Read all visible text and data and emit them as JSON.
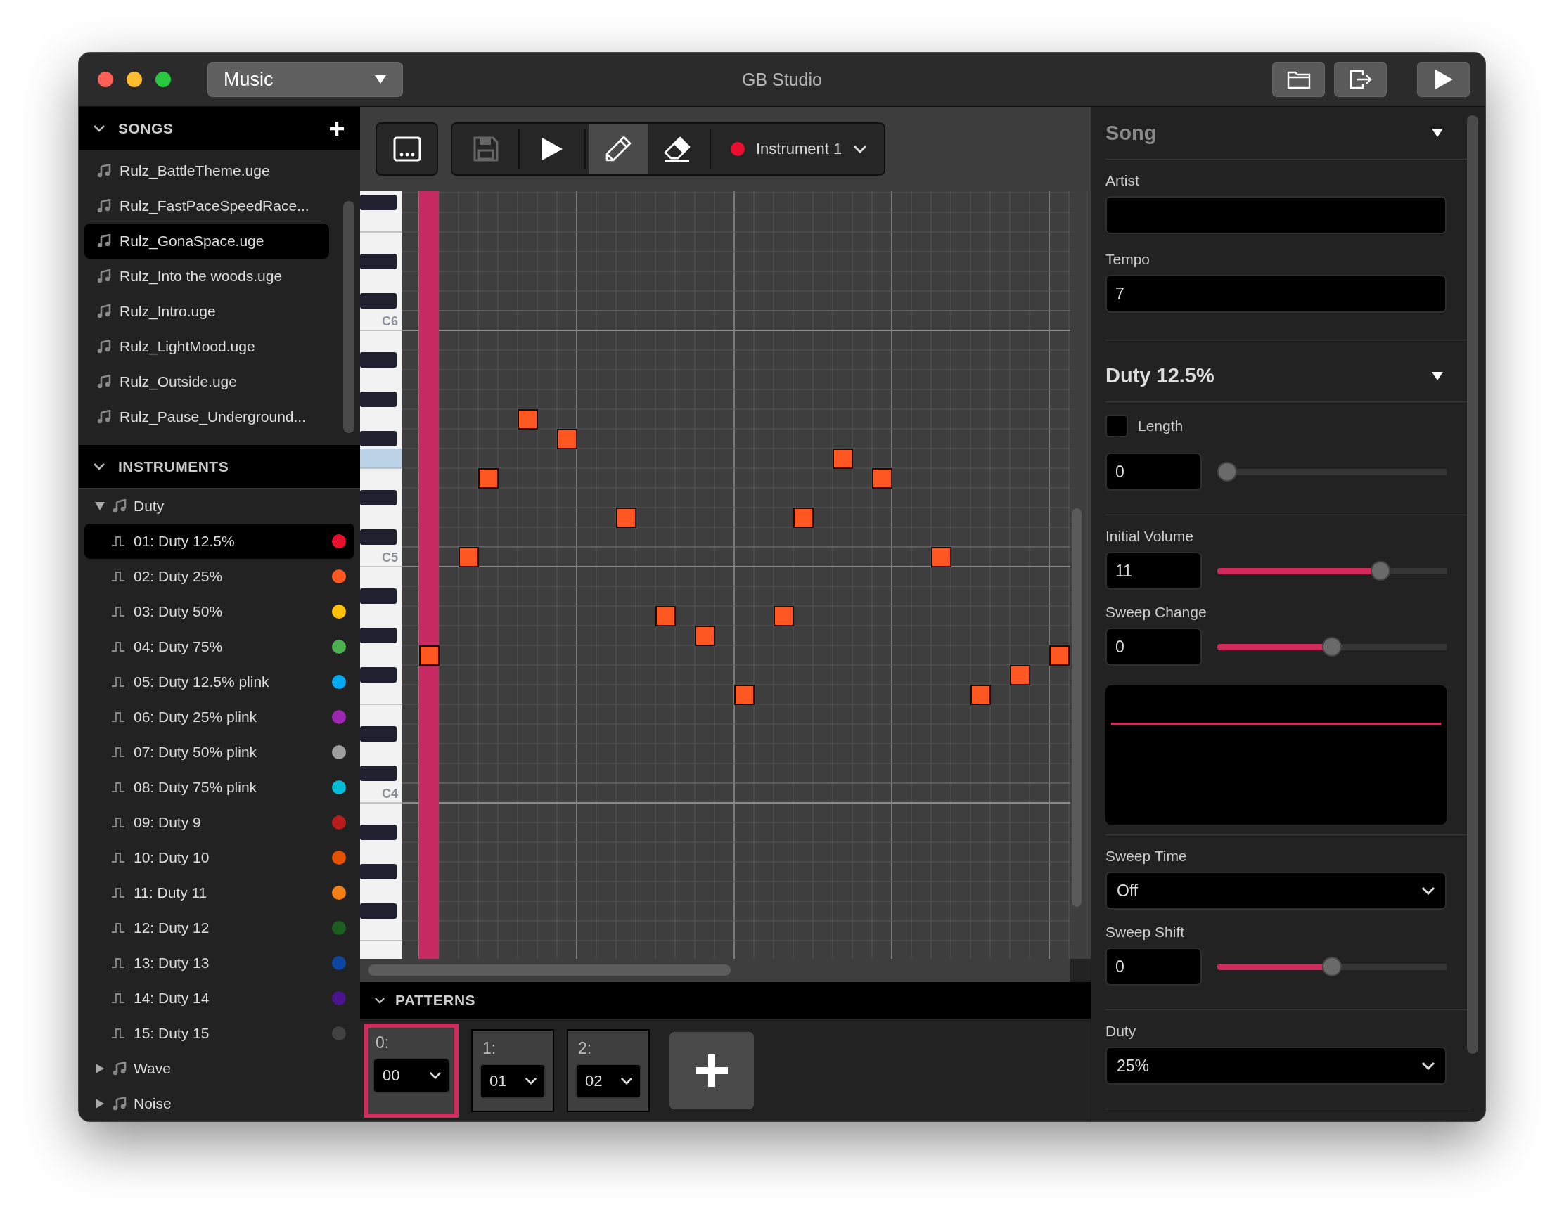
{
  "window": {
    "title": "GB Studio"
  },
  "section_dropdown": {
    "value": "Music"
  },
  "sidebar": {
    "songs": {
      "title": "SONGS",
      "expanded": true,
      "items": [
        {
          "label": "Rulz_BattleTheme.uge",
          "selected": false
        },
        {
          "label": "Rulz_FastPaceSpeedRace...",
          "selected": false
        },
        {
          "label": "Rulz_GonaSpace.uge",
          "selected": true
        },
        {
          "label": "Rulz_Into the woods.uge",
          "selected": false
        },
        {
          "label": "Rulz_Intro.uge",
          "selected": false
        },
        {
          "label": "Rulz_LightMood.uge",
          "selected": false
        },
        {
          "label": "Rulz_Outside.uge",
          "selected": false
        },
        {
          "label": "Rulz_Pause_Underground...",
          "selected": false
        }
      ]
    },
    "instruments": {
      "title": "INSTRUMENTS",
      "expanded": true,
      "groups": [
        {
          "label": "Duty",
          "expanded": true,
          "children": [
            {
              "label": "01: Duty 12.5%",
              "color": "#e8102e",
              "selected": true
            },
            {
              "label": "02: Duty 25%",
              "color": "#ff5722",
              "selected": false
            },
            {
              "label": "03: Duty 50%",
              "color": "#ffc107",
              "selected": false
            },
            {
              "label": "04: Duty 75%",
              "color": "#4caf50",
              "selected": false
            },
            {
              "label": "05: Duty 12.5% plink",
              "color": "#03a9f4",
              "selected": false
            },
            {
              "label": "06: Duty 25% plink",
              "color": "#9c27b0",
              "selected": false
            },
            {
              "label": "07: Duty 50% plink",
              "color": "#9e9e9e",
              "selected": false
            },
            {
              "label": "08: Duty 75% plink",
              "color": "#00bcd4",
              "selected": false
            },
            {
              "label": "09: Duty 9",
              "color": "#b71c1c",
              "selected": false
            },
            {
              "label": "10: Duty 10",
              "color": "#e65100",
              "selected": false
            },
            {
              "label": "11: Duty 11",
              "color": "#f57f17",
              "selected": false
            },
            {
              "label": "12: Duty 12",
              "color": "#1b5e20",
              "selected": false
            },
            {
              "label": "13: Duty 13",
              "color": "#0d47a1",
              "selected": false
            },
            {
              "label": "14: Duty 14",
              "color": "#4a148c",
              "selected": false
            },
            {
              "label": "15: Duty 15",
              "color": "#424242",
              "selected": false
            }
          ]
        },
        {
          "label": "Wave",
          "expanded": false
        },
        {
          "label": "Noise",
          "expanded": false
        }
      ]
    }
  },
  "toolbar": {
    "tools": [
      {
        "kind": "save",
        "disabled": true
      },
      {
        "kind": "play",
        "disabled": false
      },
      {
        "kind": "pencil",
        "selected": true
      },
      {
        "kind": "eraser",
        "selected": false
      }
    ],
    "instrument": {
      "label": "Instrument 1",
      "color": "#e8102e"
    }
  },
  "piano_roll": {
    "key_labels": [
      "C6",
      "C5",
      "C4"
    ]
  },
  "patterns": {
    "title": "PATTERNS",
    "expanded": true,
    "items": [
      {
        "label": "0:",
        "value": "00",
        "selected": true
      },
      {
        "label": "1:",
        "value": "01",
        "selected": false
      },
      {
        "label": "2:",
        "value": "02",
        "selected": false
      }
    ]
  },
  "song_panel": {
    "title": "Song",
    "expanded": true,
    "fields": [
      {
        "label": "Artist"
      },
      {
        "label": "Tempo",
        "value": "7"
      }
    ]
  },
  "instrument_panel": {
    "title": "Duty 12.5%",
    "expanded": true,
    "sections": [
      {
        "controls": [
          {
            "kind": "checkbox",
            "label": "Length",
            "checked": false
          },
          {
            "kind": "slider",
            "value": "0",
            "level": 0
          }
        ]
      },
      {
        "controls": [
          {
            "kind": "slider",
            "label": "Initial Volume",
            "value": "11",
            "level": 0.73
          },
          {
            "kind": "slider",
            "label": "Sweep Change",
            "value": "0",
            "level": 0.5
          },
          {
            "kind": "envelope"
          }
        ]
      },
      {
        "controls": [
          {
            "kind": "select",
            "label": "Sweep Time",
            "value": "Off"
          },
          {
            "kind": "slider",
            "label": "Sweep Shift",
            "value": "0",
            "level": 0.5
          }
        ]
      },
      {
        "controls": [
          {
            "kind": "select",
            "label": "Duty",
            "value": "25%"
          }
        ]
      }
    ]
  }
}
